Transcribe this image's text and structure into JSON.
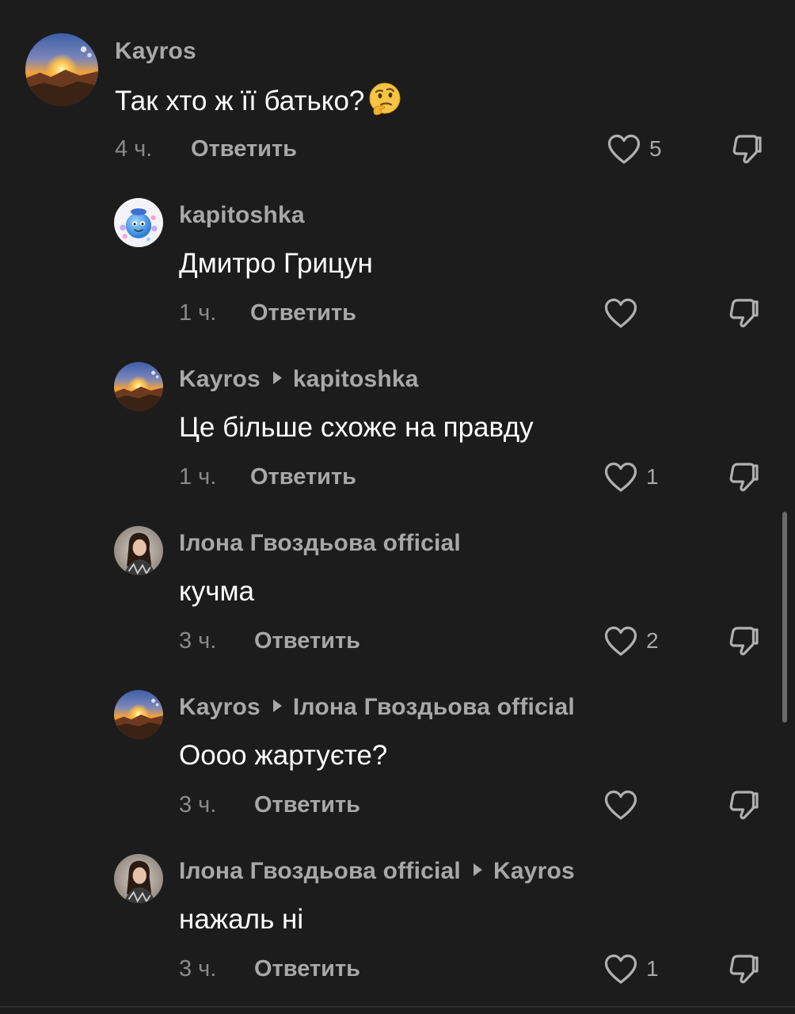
{
  "comments": [
    {
      "author": "Kayros",
      "reply_to": "",
      "text": "Так хто ж її батько?",
      "emoji": "thinking-face-emoji",
      "time": "4 ч.",
      "reply_label": "Ответить",
      "likes": "5",
      "avatar": "sunset-landscape"
    },
    {
      "author": "kapitoshka",
      "reply_to": "",
      "text": "Дмитро Грицун",
      "time": "1 ч.",
      "reply_label": "Ответить",
      "likes": "",
      "avatar": "blue-cartoon-character"
    },
    {
      "author": "Kayros",
      "reply_to": "kapitoshka",
      "text": "Це більше схоже на правду",
      "time": "1 ч.",
      "reply_label": "Ответить",
      "likes": "1",
      "avatar": "sunset-landscape"
    },
    {
      "author": "Ілона Гвоздьова official",
      "reply_to": "",
      "text": "кучма",
      "time": "3 ч.",
      "reply_label": "Ответить",
      "likes": "2",
      "avatar": "woman-portrait"
    },
    {
      "author": "Kayros",
      "reply_to": "Ілона Гвоздьова official",
      "text": "Оооо жартуєте?",
      "time": "3 ч.",
      "reply_label": "Ответить",
      "likes": "",
      "avatar": "sunset-landscape"
    },
    {
      "author": "Ілона Гвоздьова official",
      "reply_to": "Kayros",
      "text": "нажаль ні",
      "time": "3 ч.",
      "reply_label": "Ответить",
      "likes": "1",
      "avatar": "woman-portrait"
    }
  ],
  "colors": {
    "background": "#1c1c1c",
    "username": "#a8a8a8",
    "text": "#ffffff",
    "meta": "#8a8a8a"
  },
  "icons": {
    "like": "heart-outline-icon",
    "dislike": "thumbs-down-outline-icon"
  }
}
